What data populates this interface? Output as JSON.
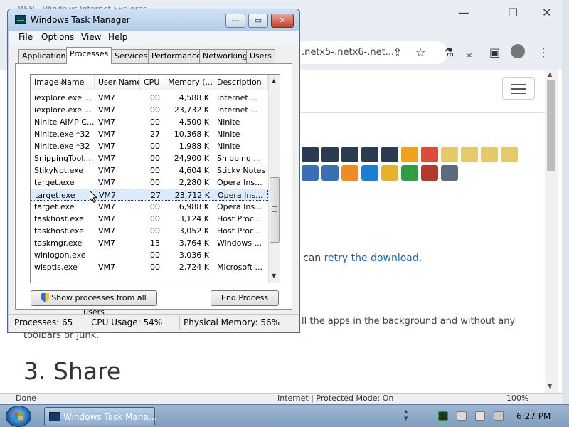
{
  "browser": {
    "title": "MSN - Windows Internet Explorer",
    "url": ".netx5-.netx6-.net...",
    "retry_prefix": "can",
    "retry_link": "retry the download.",
    "paragraph_right": "ll the apps in the background and without any",
    "paragraph_left": "toolbars or junk.",
    "share_heading": "3. Share",
    "status_done": "Done",
    "status_zone": "Internet | Protected Mode: On",
    "status_zoom": "100%",
    "icons_row1": [
      "#2a3b52",
      "#2a3b52",
      "#2a3b52",
      "#2a3b52",
      "#2a3b52",
      "#f2a11c",
      "#dd4b39",
      "#e8c96a",
      "#e8c96a",
      "#e8c96a",
      "#e8c96a"
    ],
    "icons_row2": [
      "#3b6fb5",
      "#3b6fb5",
      "#f08a24",
      "#1b7fd4",
      "#e6b22a",
      "#2f9e44",
      "#b03a2e",
      "#5c6b7d"
    ]
  },
  "task_manager": {
    "title": "Windows Task Manager",
    "menu": [
      "File",
      "Options",
      "View",
      "Help"
    ],
    "tabs": [
      "Applications",
      "Processes",
      "Services",
      "Performance",
      "Networking",
      "Users"
    ],
    "columns": [
      "Image Name",
      "User Name",
      "CPU",
      "Memory (...",
      "Description"
    ],
    "processes": [
      {
        "name": "iexplore.exe ...",
        "user": "VM7",
        "cpu": "00",
        "memory": "4,588 K",
        "description": "Internet ..."
      },
      {
        "name": "iexplore.exe ...",
        "user": "VM7",
        "cpu": "00",
        "memory": "23,732 K",
        "description": "Internet ..."
      },
      {
        "name": "Ninite AIMP C...",
        "user": "VM7",
        "cpu": "00",
        "memory": "4,500 K",
        "description": "Ninite"
      },
      {
        "name": "Ninite.exe *32",
        "user": "VM7",
        "cpu": "27",
        "memory": "10,368 K",
        "description": "Ninite"
      },
      {
        "name": "Ninite.exe *32",
        "user": "VM7",
        "cpu": "00",
        "memory": "1,988 K",
        "description": "Ninite"
      },
      {
        "name": "SnippingTool....",
        "user": "VM7",
        "cpu": "00",
        "memory": "24,900 K",
        "description": "Snipping ..."
      },
      {
        "name": "StikyNot.exe",
        "user": "VM7",
        "cpu": "00",
        "memory": "4,604 K",
        "description": "Sticky Notes"
      },
      {
        "name": "target.exe",
        "user": "VM7",
        "cpu": "00",
        "memory": "2,280 K",
        "description": "Opera Ins..."
      },
      {
        "name": "target.exe",
        "user": "VM7",
        "cpu": "27",
        "memory": "23,712 K",
        "description": "Opera Ins...",
        "selected": true
      },
      {
        "name": "target.exe",
        "user": "VM7",
        "cpu": "00",
        "memory": "6,988 K",
        "description": "Opera Ins..."
      },
      {
        "name": "taskhost.exe",
        "user": "VM7",
        "cpu": "00",
        "memory": "3,124 K",
        "description": "Host Proc..."
      },
      {
        "name": "taskhost.exe",
        "user": "VM7",
        "cpu": "00",
        "memory": "3,052 K",
        "description": "Host Proc..."
      },
      {
        "name": "taskmgr.exe",
        "user": "VM7",
        "cpu": "13",
        "memory": "3,764 K",
        "description": "Windows ..."
      },
      {
        "name": "winlogon.exe",
        "user": "",
        "cpu": "00",
        "memory": "3,036 K",
        "description": ""
      },
      {
        "name": "wisptis.exe",
        "user": "VM7",
        "cpu": "00",
        "memory": "2,724 K",
        "description": "Microsoft ..."
      }
    ],
    "show_all_label": "Show processes from all users",
    "end_process_label": "End Process",
    "status": {
      "processes": "Processes: 65",
      "cpu": "CPU Usage: 54%",
      "memory": "Physical Memory: 56%"
    }
  },
  "taskbar": {
    "task_label": "Windows Task Mana...",
    "clock": "6:27 PM"
  }
}
